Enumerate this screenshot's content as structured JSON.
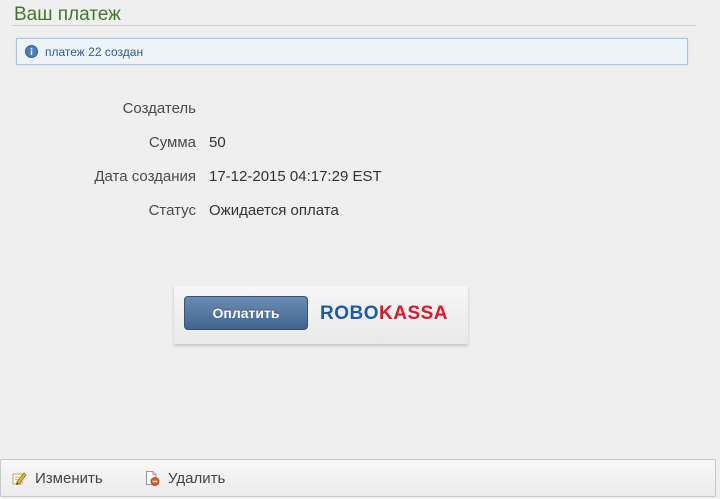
{
  "page": {
    "title": "Ваш платеж"
  },
  "notice": {
    "icon": "info-icon",
    "text": "платеж 22 создан"
  },
  "details": {
    "rows": [
      {
        "label": "Создатель",
        "value": ""
      },
      {
        "label": "Сумма",
        "value": "50"
      },
      {
        "label": "Дата создания",
        "value": "17-12-2015 04:17:29 EST"
      },
      {
        "label": "Статус",
        "value": "Ожидается оплата"
      }
    ]
  },
  "payment": {
    "button_label": "Оплатить",
    "brand_part1": "ROBO",
    "brand_part2": "KASSA"
  },
  "actions": {
    "edit_label": "Изменить",
    "edit_icon": "pencil-icon",
    "delete_label": "Удалить",
    "delete_icon": "delete-document-icon"
  }
}
